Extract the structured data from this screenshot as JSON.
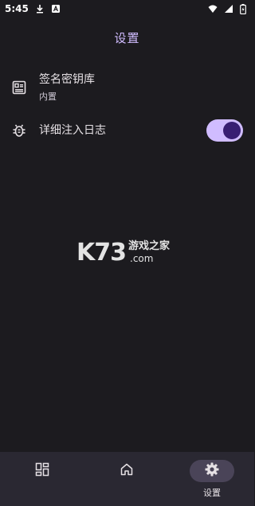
{
  "status_bar": {
    "time": "5:45",
    "icons_left": [
      "download-icon",
      "a-notification-icon"
    ],
    "icons_right": [
      "wifi-icon",
      "cellular-signal-icon",
      "battery-icon"
    ]
  },
  "header": {
    "title": "设置"
  },
  "settings": {
    "keystore": {
      "title": "签名密钥库",
      "subtitle": "内置",
      "icon": "keystore-card-icon"
    },
    "verbose_log": {
      "title": "详细注入日志",
      "icon": "bug-icon",
      "enabled": true
    }
  },
  "watermark": {
    "brand": "K73",
    "site": "游戏之家",
    "domain": ".com"
  },
  "bottom_nav": {
    "items": [
      {
        "icon": "dashboard-grid-icon",
        "label": ""
      },
      {
        "icon": "home-icon",
        "label": ""
      },
      {
        "icon": "gear-icon",
        "label": "设置",
        "active": true
      }
    ]
  },
  "colors": {
    "background": "#1c1b1f",
    "accent": "#d0bcff",
    "switch_knob": "#381e72",
    "nav_background": "#2a2832",
    "nav_active_pill": "#4a4458"
  }
}
